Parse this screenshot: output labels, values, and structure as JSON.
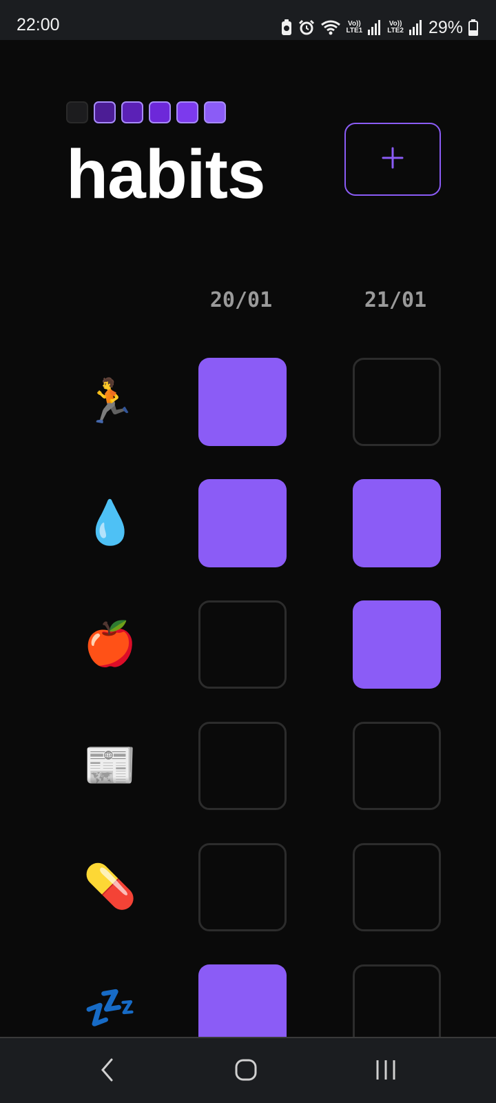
{
  "status_bar": {
    "time": "22:00",
    "battery_percent": "29%",
    "sim1_label_top": "Vo))",
    "sim1_label_bottom": "LTE1",
    "sim2_label_top": "Vo))",
    "sim2_label_bottom": "LTE2",
    "icons": [
      "battery-saver-icon",
      "alarm-icon",
      "wifi-icon",
      "signal-icon",
      "signal-icon",
      "battery-icon"
    ]
  },
  "header": {
    "title": "habits",
    "add_icon": "plus-icon",
    "progress_colors": [
      "#1c1c1e",
      "#4c1d95",
      "#5b21b6",
      "#6d28d9",
      "#7c3aed",
      "#8b5cf6"
    ]
  },
  "dates": [
    "20/01",
    "21/01"
  ],
  "accent_color": "#8b5cf6",
  "habits": [
    {
      "emoji": "🏃",
      "icon_name": "runner-icon",
      "checks": [
        true,
        false
      ]
    },
    {
      "emoji": "💧",
      "icon_name": "water-drop-icon",
      "checks": [
        true,
        true
      ]
    },
    {
      "emoji": "🍎",
      "icon_name": "apple-icon",
      "checks": [
        false,
        true
      ]
    },
    {
      "emoji": "📰",
      "icon_name": "newspaper-icon",
      "checks": [
        false,
        false
      ]
    },
    {
      "emoji": "💊",
      "icon_name": "pill-icon",
      "checks": [
        false,
        false
      ]
    },
    {
      "emoji": "💤",
      "icon_name": "sleep-icon",
      "checks": [
        true,
        false
      ]
    }
  ],
  "nav": {
    "icons": [
      "back-icon",
      "home-icon",
      "recents-icon"
    ]
  }
}
